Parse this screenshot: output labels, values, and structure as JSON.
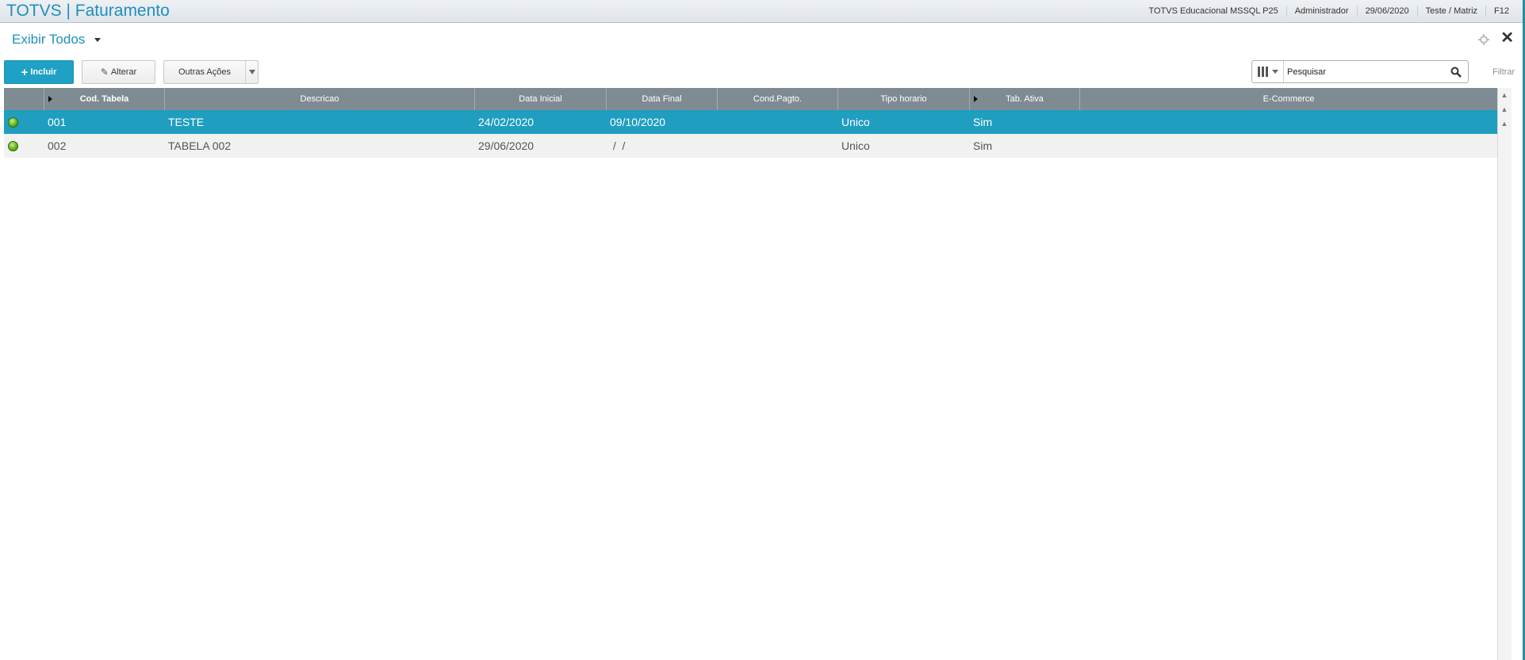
{
  "topbar": {
    "title": "TOTVS | Faturamento",
    "environment": "TOTVS Educacional MSSQL P25",
    "user": "Administrador",
    "date": "29/06/2020",
    "branch": "Teste / Matriz",
    "help_key": "F12"
  },
  "view": {
    "title": "Exibir Todos"
  },
  "toolbar": {
    "add_label": "Incluir",
    "edit_label": "Alterar",
    "other_actions_label": "Outras Ações"
  },
  "search": {
    "placeholder": "Pesquisar",
    "filter_label": "Filtrar"
  },
  "grid": {
    "columns": [
      "Cod. Tabela",
      "Descricao",
      "Data Inicial",
      "Data Final",
      "Cond.Pagto.",
      "Tipo horario",
      "Tab. Ativa",
      "E-Commerce"
    ],
    "rows": [
      {
        "status": "green",
        "cod": "001",
        "descricao": "TESTE",
        "data_inicial": "24/02/2020",
        "data_final": "09/10/2020",
        "cond_pagto": "",
        "tipo_horario": "Unico",
        "tab_ativa": "Sim",
        "ecommerce": ""
      },
      {
        "status": "green",
        "cod": "002",
        "descricao": "TABELA 002",
        "data_inicial": "29/06/2020",
        "data_final": " /  /",
        "cond_pagto": "",
        "tipo_horario": "Unico",
        "tab_ativa": "Sim",
        "ecommerce": ""
      }
    ]
  },
  "colors": {
    "accent": "#1fa1c5",
    "header_bg": "#7f8b92",
    "selected_row": "#1f9ec0",
    "status_active": "#53a80f"
  }
}
